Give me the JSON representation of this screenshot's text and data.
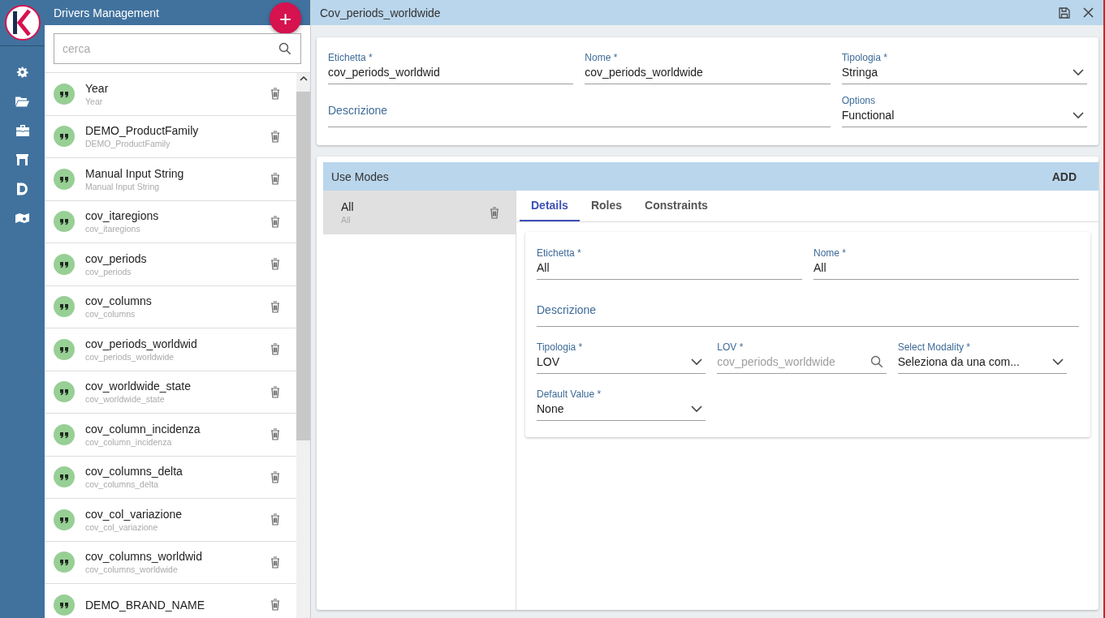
{
  "drivers_panel": {
    "title": "Drivers Management",
    "add_button": "+",
    "search": {
      "placeholder": "cerca"
    },
    "items": [
      {
        "label": "Year",
        "name": "Year"
      },
      {
        "label": "DEMO_ProductFamily",
        "name": "DEMO_ProductFamily"
      },
      {
        "label": "Manual Input String",
        "name": "Manual Input String"
      },
      {
        "label": "cov_itaregions",
        "name": "cov_itaregions"
      },
      {
        "label": "cov_periods",
        "name": "cov_periods"
      },
      {
        "label": "cov_columns",
        "name": "cov_columns"
      },
      {
        "label": "cov_periods_worldwid",
        "name": "cov_periods_worldwide"
      },
      {
        "label": "cov_worldwide_state",
        "name": "cov_worldwide_state"
      },
      {
        "label": "cov_column_incidenza",
        "name": "cov_column_incidenza"
      },
      {
        "label": "cov_columns_delta",
        "name": "cov_columns_delta"
      },
      {
        "label": "cov_col_variazione",
        "name": "cov_col_variazione"
      },
      {
        "label": "cov_columns_worldwid",
        "name": "cov_columns_worldwide"
      },
      {
        "label": "DEMO_BRAND_NAME"
      }
    ]
  },
  "detail": {
    "title": "Cov_periods_worldwide",
    "form": [
      [
        {
          "kind": "text",
          "label": "Etichetta *",
          "value": "cov_periods_worldwid"
        },
        {
          "kind": "text",
          "label": "Nome *",
          "value": "cov_periods_worldwide"
        },
        {
          "kind": "select",
          "label": "Tipologia *",
          "value": "Stringa"
        }
      ],
      [
        {
          "kind": "text",
          "label": "Descrizione"
        },
        {
          "kind": "select",
          "label": "Options",
          "value": "Functional"
        }
      ]
    ],
    "use_modes": {
      "title": "Use Modes",
      "add_button": "ADD",
      "items": [
        {
          "label": "All",
          "name": "All",
          "selected": true
        }
      ],
      "tabs": [
        {
          "label": "Details",
          "selected": true
        },
        {
          "label": "Roles",
          "selected": false
        },
        {
          "label": "Constraints",
          "selected": false
        }
      ],
      "form": [
        [
          {
            "kind": "text",
            "label": "Etichetta *",
            "value": "All"
          },
          {
            "kind": "text",
            "label": "Nome *",
            "value": "All"
          }
        ],
        [
          {
            "kind": "text",
            "label": "Descrizione"
          }
        ],
        [
          {
            "kind": "select",
            "label": "Tipologia *",
            "value": "LOV"
          },
          {
            "kind": "search",
            "label": "LOV *",
            "value": "cov_periods_worldwide",
            "disabled": true
          },
          {
            "kind": "select",
            "label": "Select Modality *",
            "value": "Seleziona da una com..."
          }
        ],
        [
          {
            "kind": "select",
            "label": "Default Value *",
            "value": "None"
          }
        ]
      ]
    }
  }
}
